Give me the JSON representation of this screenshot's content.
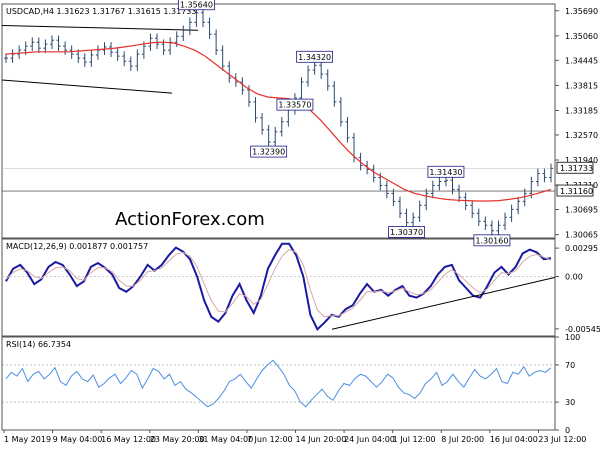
{
  "chart_data": [
    {
      "type": "line",
      "panel": "price",
      "header": {
        "symbol": "USDCAD,H4",
        "ohlc": "1.31623 1.31767 1.31615 1.31733"
      },
      "watermark": "ActionForex.com",
      "y_ticks": [
        "1.35690",
        "1.35060",
        "1.34445",
        "1.33815",
        "1.33185",
        "1.32570",
        "1.31940",
        "1.31310",
        "1.30695",
        "1.30065"
      ],
      "ylim": [
        1.2998,
        1.3586
      ],
      "last_price_label": "1.31733",
      "level_label": "1.31160",
      "level_value": 1.3116,
      "price_candles_close": [
        1.345,
        1.346,
        1.347,
        1.348,
        1.349,
        1.3475,
        1.3485,
        1.3495,
        1.348,
        1.347,
        1.346,
        1.345,
        1.344,
        1.3458,
        1.347,
        1.3478,
        1.3465,
        1.3455,
        1.3442,
        1.343,
        1.346,
        1.348,
        1.35,
        1.3485,
        1.347,
        1.349,
        1.3505,
        1.352,
        1.354,
        1.3564,
        1.354,
        1.351,
        1.347,
        1.343,
        1.34,
        1.339,
        1.337,
        1.334,
        1.33,
        1.327,
        1.3239,
        1.3265,
        1.329,
        1.332,
        1.335,
        1.339,
        1.342,
        1.3432,
        1.341,
        1.338,
        1.334,
        1.329,
        1.325,
        1.32,
        1.318,
        1.317,
        1.315,
        1.313,
        1.311,
        1.309,
        1.306,
        1.3037,
        1.305,
        1.308,
        1.311,
        1.313,
        1.314,
        1.3143,
        1.312,
        1.31,
        1.308,
        1.306,
        1.304,
        1.303,
        1.3016,
        1.303,
        1.305,
        1.307,
        1.309,
        1.311,
        1.314,
        1.316,
        1.315,
        1.3173
      ],
      "ma_line": [
        1.346,
        1.3462,
        1.3464,
        1.3466,
        1.3466,
        1.3466,
        1.3466,
        1.3468,
        1.347,
        1.3472,
        1.3474,
        1.3477,
        1.3481,
        1.3485,
        1.3489,
        1.349,
        1.3488,
        1.348,
        1.347,
        1.3455,
        1.3435,
        1.3415,
        1.3395,
        1.3375,
        1.336,
        1.3352,
        1.335,
        1.3348,
        1.334,
        1.332,
        1.3295,
        1.3265,
        1.3235,
        1.3208,
        1.3185,
        1.3165,
        1.315,
        1.3135,
        1.312,
        1.311,
        1.3104,
        1.3099,
        1.3095,
        1.3093,
        1.3092,
        1.3091,
        1.3091,
        1.3092,
        1.3095,
        1.3099,
        1.3105,
        1.3112,
        1.312
      ],
      "annotations": [
        "1.35640",
        "1.33570",
        "1.34320",
        "1.32390",
        "1.31430",
        "1.30370",
        "1.30160"
      ]
    },
    {
      "type": "line",
      "panel": "macd",
      "header": "MACD(12,26,9) 0.001877 0.001757",
      "y_ticks": [
        "0.00295",
        "0.00",
        "-0.005455"
      ],
      "ylim": [
        -0.0062,
        0.0039
      ],
      "series": [
        {
          "name": "MACD",
          "values": [
            -0.0005,
            0.0008,
            0.0012,
            0.0004,
            -0.0008,
            -0.0003,
            0.001,
            0.0015,
            0.0012,
            0.0002,
            -0.001,
            -0.0005,
            0.001,
            0.0014,
            0.0009,
            0.0002,
            -0.0012,
            -0.0016,
            -0.001,
            0.0,
            0.0012,
            0.0006,
            0.0012,
            0.0022,
            0.003,
            0.0026,
            0.0018,
            0.0,
            -0.0025,
            -0.0042,
            -0.0047,
            -0.0038,
            -0.002,
            -0.0008,
            -0.0025,
            -0.0038,
            -0.002,
            0.0008,
            0.0022,
            0.0034,
            0.0034,
            0.0022,
            0.0,
            -0.004,
            -0.0055,
            -0.0048,
            -0.004,
            -0.0042,
            -0.0034,
            -0.003,
            -0.0018,
            -0.0008,
            -0.0016,
            -0.0014,
            -0.002,
            -0.0014,
            -0.001,
            -0.002,
            -0.0022,
            -0.0018,
            -0.001,
            0.0002,
            0.001,
            0.0012,
            -0.0004,
            -0.0012,
            -0.002,
            -0.0022,
            -0.001,
            0.0004,
            0.001,
            0.0002,
            0.001,
            0.0024,
            0.0028,
            0.0025,
            0.0018,
            0.0019
          ]
        },
        {
          "name": "Signal",
          "values": [
            -0.0003,
            0.0004,
            0.0008,
            0.0006,
            0.0,
            -0.0002,
            0.0004,
            0.0009,
            0.001,
            0.0006,
            -0.0002,
            -0.0004,
            0.0004,
            0.0009,
            0.0009,
            0.0005,
            -0.0004,
            -0.001,
            -0.001,
            -0.0004,
            0.0005,
            0.0006,
            0.0009,
            0.0016,
            0.0023,
            0.0025,
            0.0021,
            0.001,
            -0.0008,
            -0.0025,
            -0.0036,
            -0.0037,
            -0.0028,
            -0.0018,
            -0.0021,
            -0.0029,
            -0.0024,
            -0.0008,
            0.0008,
            0.0021,
            0.0028,
            0.0025,
            0.0012,
            -0.0014,
            -0.0035,
            -0.0042,
            -0.0041,
            -0.0041,
            -0.0037,
            -0.0033,
            -0.0025,
            -0.0016,
            -0.0016,
            -0.0015,
            -0.0017,
            -0.0015,
            -0.0012,
            -0.0016,
            -0.0019,
            -0.0018,
            -0.0014,
            -0.0006,
            0.0002,
            0.0007,
            0.0002,
            -0.0005,
            -0.0012,
            -0.0017,
            -0.0013,
            -0.0004,
            0.0004,
            0.0003,
            0.0006,
            0.0015,
            0.0021,
            0.0023,
            0.002,
            0.0017
          ]
        }
      ]
    },
    {
      "type": "line",
      "panel": "rsi",
      "header": "RSI(14) 66.7354",
      "y_ticks": [
        "100",
        "70",
        "30",
        "0"
      ],
      "ylim": [
        0,
        100
      ],
      "series": [
        {
          "name": "RSI",
          "values": [
            55,
            62,
            58,
            66,
            52,
            60,
            63,
            55,
            60,
            67,
            52,
            48,
            58,
            63,
            55,
            52,
            59,
            46,
            50,
            56,
            60,
            50,
            56,
            64,
            60,
            45,
            55,
            66,
            63,
            55,
            60,
            48,
            52,
            44,
            40,
            35,
            30,
            25,
            28,
            34,
            42,
            52,
            55,
            60,
            52,
            45,
            55,
            64,
            70,
            75,
            68,
            60,
            48,
            42,
            30,
            25,
            32,
            38,
            44,
            36,
            32,
            42,
            50,
            48,
            55,
            60,
            58,
            52,
            46,
            52,
            60,
            56,
            46,
            40,
            38,
            34,
            40,
            50,
            55,
            62,
            48,
            52,
            60,
            52,
            46,
            56,
            65,
            58,
            55,
            60,
            66,
            52,
            50,
            62,
            60,
            68,
            58,
            62,
            64,
            62,
            67
          ]
        }
      ]
    }
  ],
  "x_axis_labels": [
    "1 May 2019",
    "9 May 04:00",
    "16 May 12:00",
    "23 May 20:00",
    "31 May 04:00",
    "7 Jun 12:00",
    "14 Jun 20:00",
    "24 Jun 04:00",
    "1 Jul 12:00",
    "8 Jul 20:00",
    "16 Jul 04:00",
    "23 Jul 12:00"
  ],
  "colors": {
    "candle": "#2b4a6f",
    "ma": "#e8302a",
    "macd": "#1a1aa0",
    "signal": "#d8a8a8",
    "rsi": "#4a90e0",
    "trendline": "#000000",
    "watermark": "#c9ced4"
  }
}
